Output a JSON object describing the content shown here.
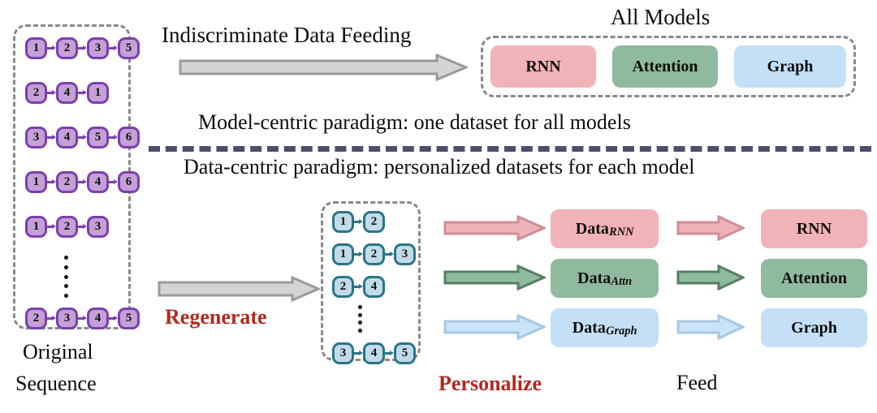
{
  "figure": {
    "top_section": {
      "feeding_label": "Indiscriminate Data Feeding",
      "all_models_title": "All Models",
      "paradigm_caption": "Model-centric paradigm: one dataset for all models",
      "models": [
        {
          "label": "RNN",
          "color": "#f2b3b8"
        },
        {
          "label": "Attention",
          "color": "#8fba9d"
        },
        {
          "label": "Graph",
          "color": "#c3e0f7"
        }
      ]
    },
    "bottom_section": {
      "paradigm_caption": "Data-centric paradigm: personalized datasets for each model",
      "regenerate_label": "Regenerate",
      "personalize_label": "Personalize",
      "feed_label": "Feed",
      "datasets": [
        {
          "base": "Data",
          "subscript": "RNN",
          "color": "#f2b3b8"
        },
        {
          "base": "Data",
          "subscript": "Attn",
          "color": "#8fba9d"
        },
        {
          "base": "Data",
          "subscript": "Graph",
          "color": "#c3e0f7"
        }
      ],
      "models": [
        {
          "label": "RNN",
          "color": "#f2b3b8"
        },
        {
          "label": "Attention",
          "color": "#8fba9d"
        },
        {
          "label": "Graph",
          "color": "#c3e0f7"
        }
      ]
    },
    "original_panel": {
      "caption_line1": "Original",
      "caption_line2": "Sequence",
      "node_fill": "#c3a0d6",
      "node_border": "#7c3fad",
      "sequences": [
        [
          "1",
          "2",
          "3",
          "5"
        ],
        [
          "2",
          "4",
          "1"
        ],
        [
          "3",
          "4",
          "5",
          "6"
        ],
        [
          "1",
          "2",
          "4",
          "6"
        ],
        [
          "1",
          "2",
          "3"
        ],
        [
          "2",
          "3",
          "4",
          "5"
        ]
      ],
      "ellipsis_after_index": 4,
      "ellipsis_dots": 5
    },
    "regenerated_panel": {
      "node_fill": "#c2dbe8",
      "node_border": "#2b7487",
      "sequences": [
        [
          "1",
          "2"
        ],
        [
          "1",
          "2",
          "3"
        ],
        [
          "2",
          "4"
        ],
        [
          "3",
          "4",
          "5"
        ]
      ],
      "ellipsis_after_index": 2,
      "ellipsis_dots": 4
    },
    "colors": {
      "divider": "#4c4f6b",
      "dashed_border": "#8a8a8a",
      "gray_arrow_fill": "#d4d4d4",
      "gray_arrow_stroke": "#9a9a9a",
      "accent_red": "#b02a1f"
    }
  }
}
